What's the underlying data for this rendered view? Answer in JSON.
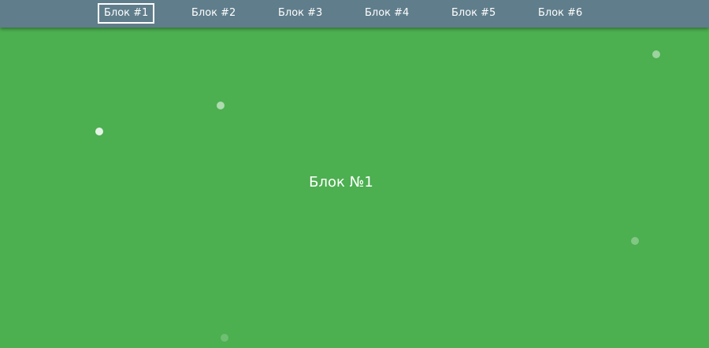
{
  "nav": {
    "items": [
      {
        "label": "Блок #1",
        "active": true
      },
      {
        "label": "Блок #2",
        "active": false
      },
      {
        "label": "Блок #3",
        "active": false
      },
      {
        "label": "Блок #4",
        "active": false
      },
      {
        "label": "Блок #5",
        "active": false
      },
      {
        "label": "Блок #6",
        "active": false
      }
    ]
  },
  "section": {
    "title": "Блок №1"
  },
  "colors": {
    "nav_background": "#607d8b",
    "section_background": "#4caf50",
    "text": "#ffffff"
  }
}
